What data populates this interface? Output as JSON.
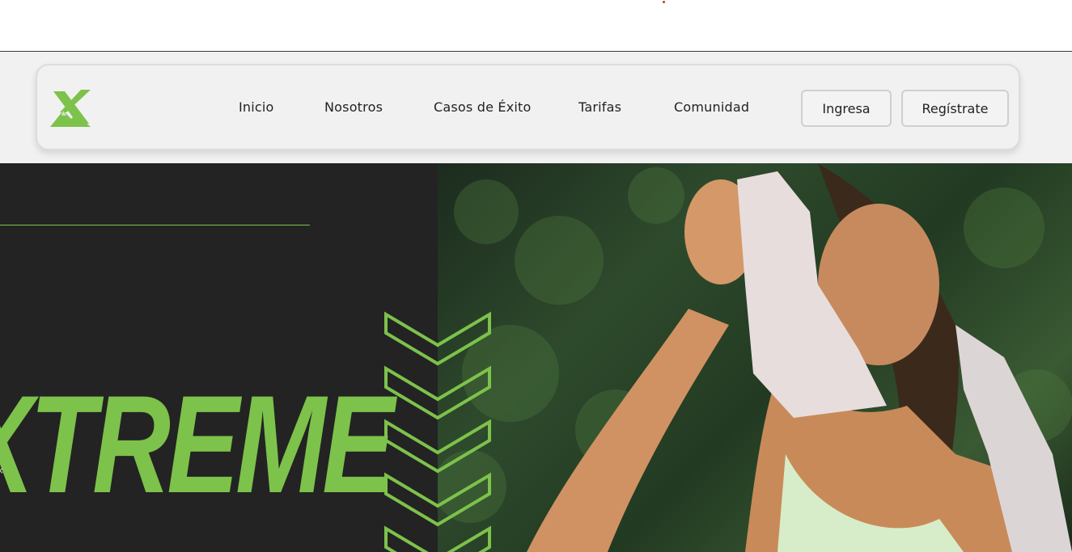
{
  "brand": {
    "logo_icon": "x-mountain-logo-icon",
    "accent": "#7dc24b"
  },
  "nav": {
    "links": [
      "Inicio",
      "Nosotros",
      "Casos de Éxito",
      "Tarifas",
      "Comunidad"
    ],
    "login_label": "Ingresa",
    "register_label": "Regístrate"
  },
  "hero": {
    "title": "XTREME",
    "prev_icon": "chevron-left-icon"
  }
}
